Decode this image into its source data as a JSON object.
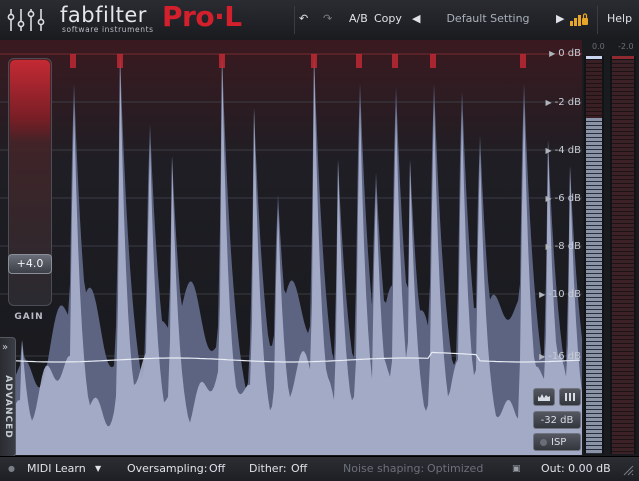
{
  "header": {
    "brand": "fabfilter",
    "tagline": "software instruments",
    "product": "Pro·L",
    "undo_icon": "undo-icon",
    "redo_icon": "redo-icon",
    "ab_label": "A/B",
    "copy_label": "Copy",
    "preset_name": "Default Setting",
    "help_label": "Help"
  },
  "display": {
    "db_scale": [
      "0 dB",
      "-2 dB",
      "-4 dB",
      "-6 dB",
      "-8 dB",
      "-10 dB",
      "-16 dB"
    ],
    "colors": {
      "waveform": "#a8b0cc",
      "clip": "#d02a36"
    }
  },
  "gain": {
    "value": "+4.0",
    "label": "GAIN",
    "level_db": 4.0
  },
  "advanced": {
    "label": "ADVANCED"
  },
  "controls": {
    "range_label": "-32 dB",
    "isp_label": "ISP"
  },
  "meters": {
    "left_peak": "0.0",
    "right_peak": "-2.0"
  },
  "footer": {
    "midi_label": "MIDI Learn",
    "oversampling_label": "Oversampling:",
    "oversampling_value": "Off",
    "dither_label": "Dither:",
    "dither_value": "Off",
    "noise_label": "Noise shaping:",
    "noise_value": "Optimized",
    "out_label": "Out: 0.00 dB"
  }
}
